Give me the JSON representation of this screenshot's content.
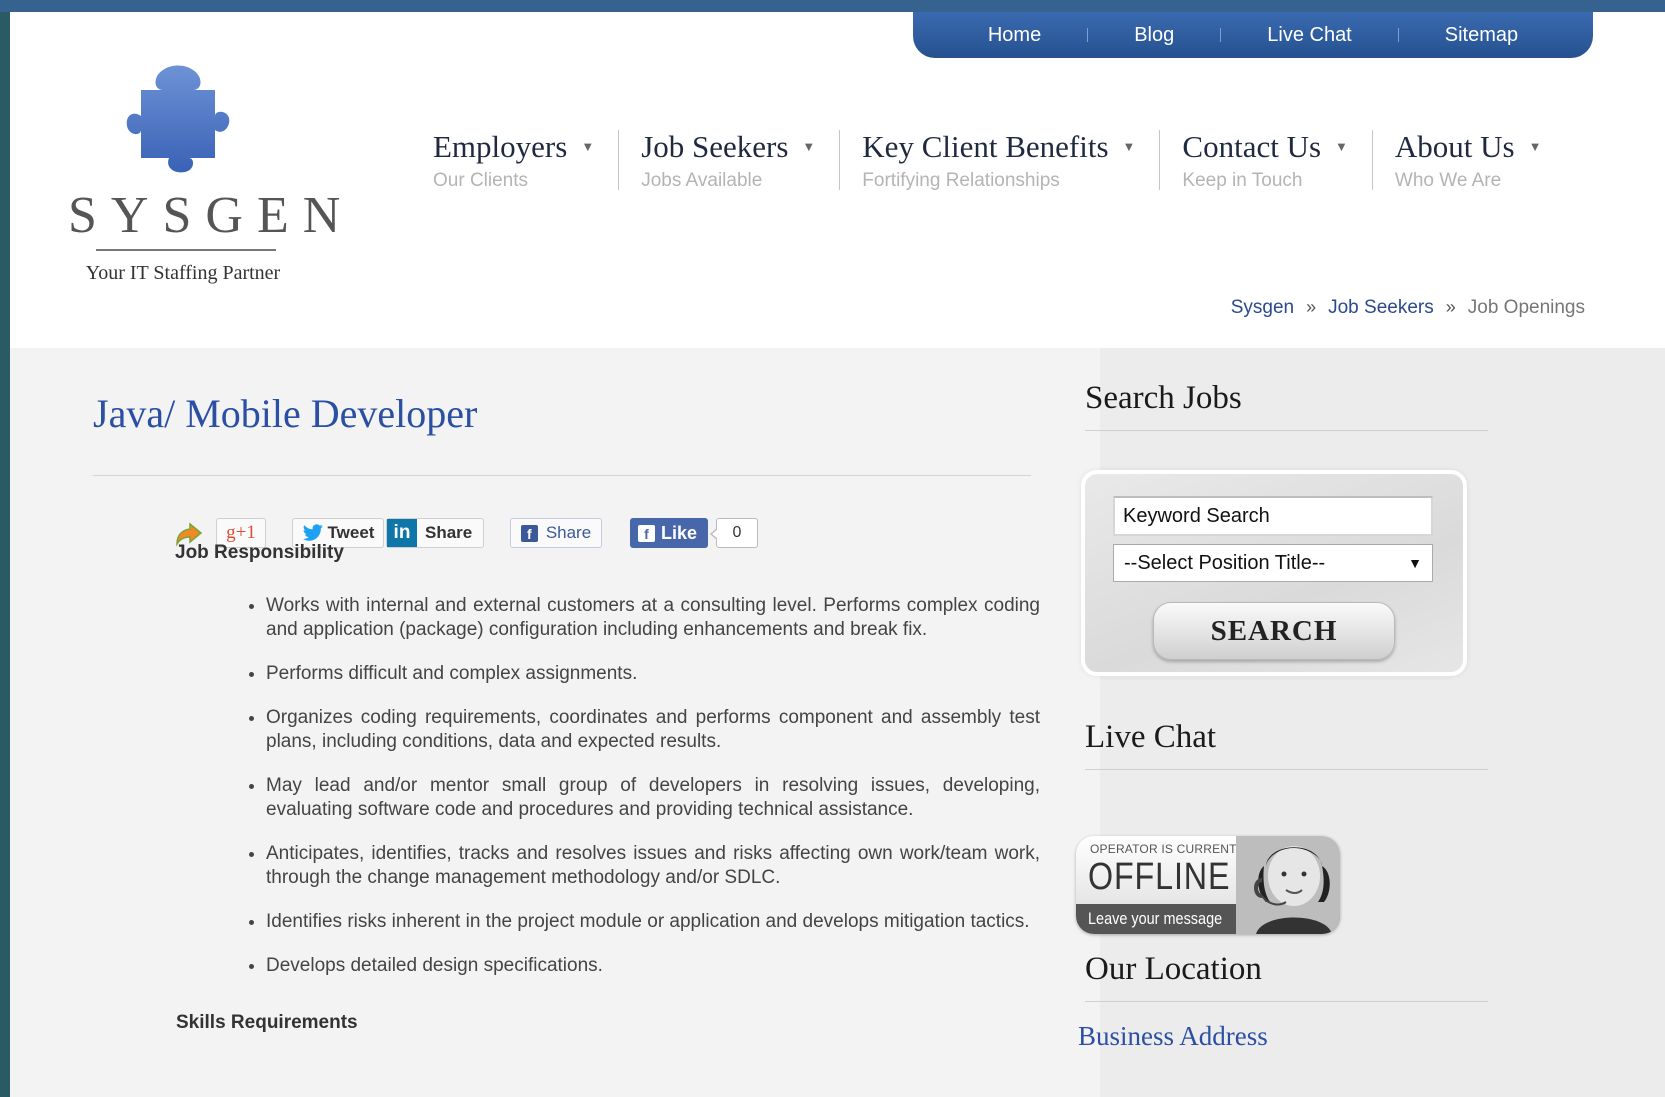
{
  "util_nav": {
    "items": [
      "Home",
      "Blog",
      "Live Chat",
      "Sitemap"
    ]
  },
  "logo": {
    "wordmark": "SYSGEN",
    "tagline": "Your IT Staffing Partner"
  },
  "main_nav": [
    {
      "title": "Employers",
      "sub": "Our Clients"
    },
    {
      "title": "Job Seekers",
      "sub": "Jobs Available"
    },
    {
      "title": "Key Client Benefits",
      "sub": "Fortifying Relationships"
    },
    {
      "title": "Contact Us",
      "sub": "Keep in Touch"
    },
    {
      "title": "About Us",
      "sub": "Who We Are"
    }
  ],
  "breadcrumb": {
    "items": [
      "Sysgen",
      "Job Seekers",
      "Job Openings"
    ],
    "separator": "»"
  },
  "job": {
    "title": "Java/ Mobile Developer",
    "responsibility_heading": "Job Responsibility",
    "responsibilities": [
      "Works with internal and external customers at a consulting level. Performs complex coding and application (package) configuration including enhancements and break fix.",
      "Performs difficult and complex assignments.",
      "Organizes coding requirements, coordinates and performs component and assembly test plans, including conditions, data and expected results.",
      "May lead and/or mentor small group of developers in resolving issues, developing, evaluating software code and procedures and providing technical assistance.",
      "Anticipates, identifies, tracks and resolves issues and risks affecting own work/team work, through the change management methodology and/or SDLC.",
      "Identifies risks inherent in the project module or application and develops mitigation tactics.",
      "Develops detailed design specifications."
    ],
    "skills_heading": "Skills Requirements"
  },
  "share_bar": {
    "gplus": "+1",
    "gplus_g": "g",
    "tweet": "Tweet",
    "linkedin_logo": "in",
    "linkedin": "Share",
    "facebook_share": "Share",
    "facebook_like": "Like",
    "like_count": "0"
  },
  "sidebar": {
    "search_heading": "Search Jobs",
    "keyword_placeholder": "Keyword Search",
    "position_select": "--Select Position Title--",
    "search_button": "SEARCH",
    "chat_heading": "Live Chat",
    "chat_status_top": "OPERATOR IS CURRENTLY",
    "chat_status": "OFFLINE",
    "chat_message": "Leave your message",
    "location_heading": "Our Location",
    "business_address": "Business Address"
  },
  "colors": {
    "brand_blue": "#2a4fa3",
    "nav_bar": "#35628f",
    "frame_bg": "#2a5a63"
  }
}
